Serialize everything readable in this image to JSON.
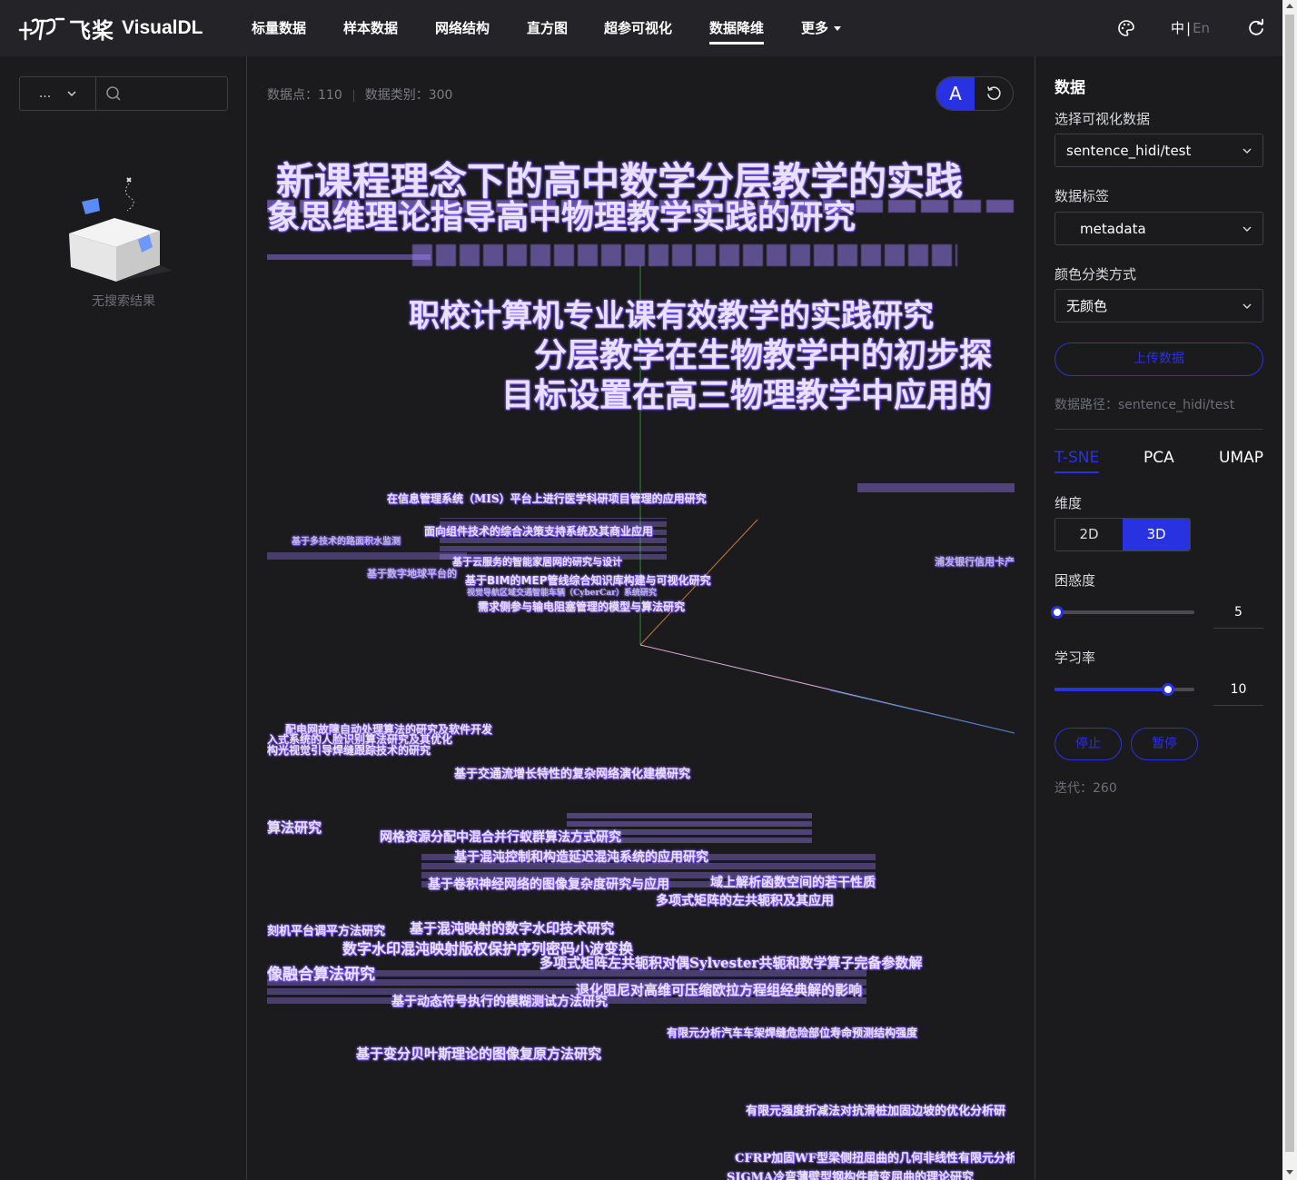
{
  "brand": {
    "name_cn": "飞桨",
    "name_en": "VisualDL"
  },
  "nav": {
    "items": [
      "标量数据",
      "样本数据",
      "网络结构",
      "直方图",
      "超参可视化",
      "数据降维",
      "更多"
    ],
    "active": "数据降维",
    "lang_cn": "中",
    "lang_sep": "|",
    "lang_en": "En"
  },
  "left": {
    "select_value": "...",
    "search_placeholder": "",
    "empty_text": "无搜索结果"
  },
  "center": {
    "points_label": "数据点：110",
    "classes_label": "数据类别：300",
    "label_toggle": "A",
    "labels": [
      "新课程理念下的高中数学分层教学的实践",
      "象思维理论指导高中物理教学实践的研究",
      "职校计算机专业课有效教学的实践研究",
      "分层教学在生物教学中的初步探",
      "目标设置在高三物理教学中应用的",
      "在信息管理系统（MIS）平台上进行医学科研项目管理的应用研究",
      "面向组件技术的综合决策支持系统及其商业应用",
      "基于多技术的路面积水监测",
      "基于云服务的智能家居网的研究与设计",
      "基于数字地球平台的",
      "基于BIM的MEP管线综合知识库构建与可视化研究",
      "视觉导航区域交通智能车辆（CyberCar）系统研究",
      "需求侧参与输电阻塞管理的模型与算法研究",
      "浦发银行信用卡产",
      "配电网故障自动处理算法的研究及软件开发",
      "入式系统的人脸识别算法研究及其优化",
      "构光视觉引导焊缝跟踪技术的研究",
      "基于交通流增长特性的复杂网络演化建模研究",
      "算法研究",
      "网格资源分配中混合并行蚁群算法方式研究",
      "基于混沌控制和构造延迟混沌系统的应用研究",
      "基于卷积神经网络的图像复杂度研究与应用",
      "域上解析函数空间的若干性质",
      "多项式矩阵的左共轭积及其应用",
      "刻机平台调平方法研究",
      "基于混沌映射的数字水印技术研究",
      "数字水印混沌映射版权保护序列密码小波变换",
      "多项式矩阵左共轭积对偶Sylvester共轭和数学算子完备参数解",
      "像融合算法研究",
      "退化阻尼对高维可压缩欧拉方程组经典解的影响",
      "基于动态符号执行的模糊测试方法研究",
      "有限元分析汽车车架焊缝危险部位寿命预测结构强度",
      "基于变分贝叶斯理论的图像复原方法研究",
      "有限元强度折减法对抗滑桩加固边坡的优化分析研",
      "CFRP加固WF型梁侧扭屈曲的几何非线性有限元分析",
      "SIGMA冷弯薄壁型钢构件畸变屈曲的理论研究"
    ]
  },
  "right": {
    "title": "数据",
    "select_data_label": "选择可视化数据",
    "select_data_value": "sentence_hidi/test",
    "data_label_label": "数据标签",
    "data_label_value": "metadata",
    "color_label": "颜色分类方式",
    "color_value": "无颜色",
    "upload_label": "上传数据",
    "data_path": "数据路径：sentence_hidi/test",
    "algorithms": [
      "T-SNE",
      "PCA",
      "UMAP"
    ],
    "active_algorithm": "T-SNE",
    "dimension_label": "维度",
    "dimension_options": [
      "2D",
      "3D"
    ],
    "active_dimension": "3D",
    "perplexity_label": "困惑度",
    "perplexity_value": "5",
    "perplexity_fraction": 0.02,
    "learning_rate_label": "学习率",
    "learning_rate_value": "10",
    "learning_rate_fraction": 0.81,
    "stop_label": "停止",
    "pause_label": "暂停",
    "iteration_label": "迭代：260"
  },
  "colors": {
    "accent": "#2932e1",
    "background": "#1b1b1d",
    "topbar": "#242428"
  }
}
